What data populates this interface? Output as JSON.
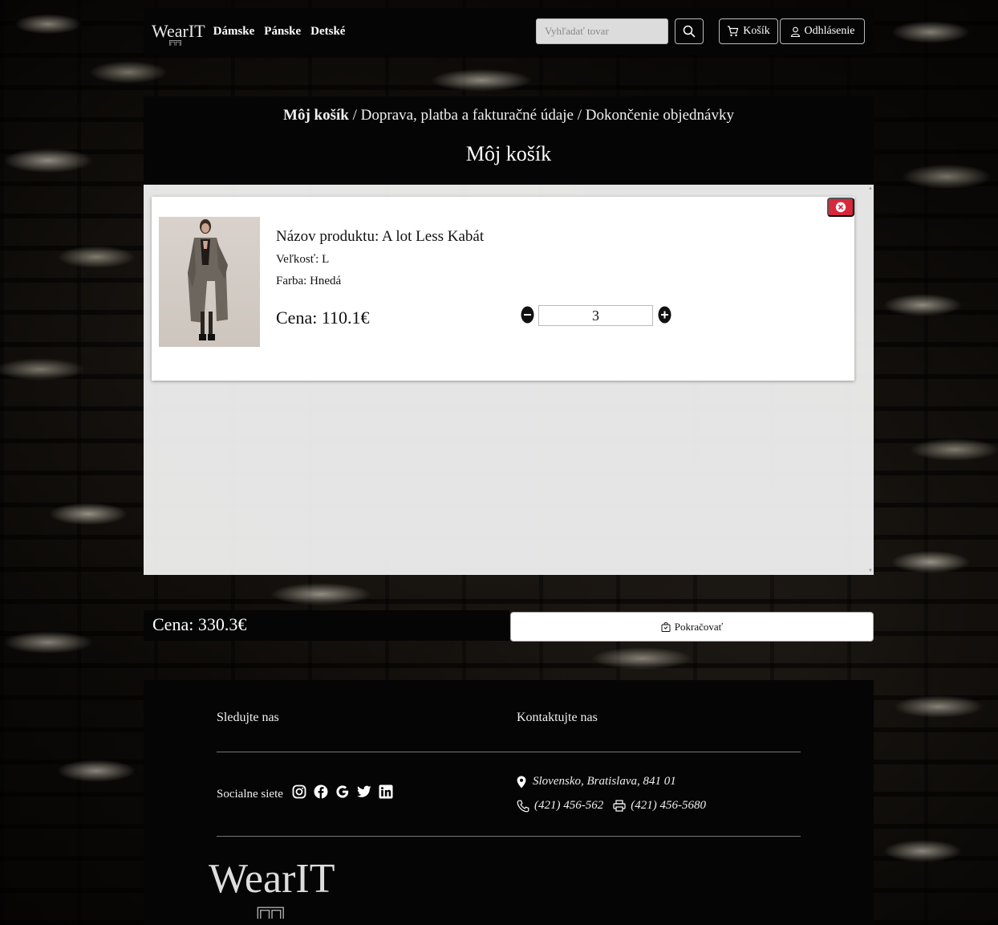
{
  "navbar": {
    "brand": "WearIT",
    "links": [
      "Dámske",
      "Pánske",
      "Detské"
    ],
    "search_placeholder": "Vyhľadať tovar",
    "cart_label": "Košík",
    "logout_label": "Odhlásenie"
  },
  "checkout": {
    "steps": [
      "Môj košík",
      "Doprava, platba a fakturačné údaje",
      "Dokončenie objednávky"
    ],
    "separator": " / ",
    "title": "Môj košík"
  },
  "cart": {
    "items": [
      {
        "name": "Názov produktu: A lot Less Kabát",
        "size": "Veľkosť: L",
        "color": "Farba: Hnedá",
        "price": "Cena: 110.1€",
        "quantity": "3"
      }
    ],
    "total": "Cena: 330.3€",
    "continue_label": "Pokračovať"
  },
  "footer": {
    "follow_heading": "Sledujte nas",
    "contact_heading": "Kontaktujte nas",
    "social_label": "Socialne siete",
    "social_icons": [
      "instagram-icon",
      "facebook-icon",
      "google-icon",
      "twitter-icon",
      "linkedin-icon"
    ],
    "address": "Slovensko, Bratislava, 841 01",
    "phone": "(421) 456-562",
    "fax": "(421) 456-5680",
    "logo": "WearIT"
  },
  "colors": {
    "dark": "#050505",
    "remove": "#d8283c",
    "panel": "#f5f5f5"
  }
}
